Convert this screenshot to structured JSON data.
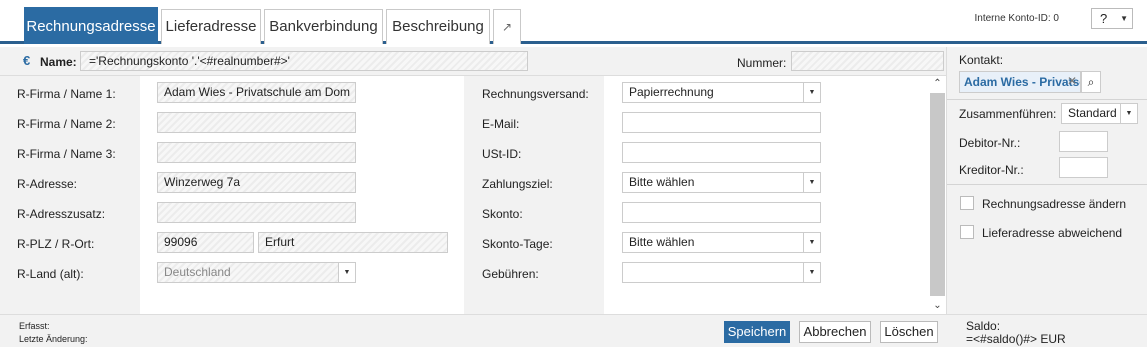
{
  "tabs": [
    {
      "label": "Rechnungsadresse",
      "active": true
    },
    {
      "label": "Lieferadresse"
    },
    {
      "label": "Bankverbindung"
    },
    {
      "label": "Beschreibung"
    }
  ],
  "expand_icon": "↗",
  "header": {
    "konto_id_label": "Interne Konto-ID: 0",
    "help_value": "?"
  },
  "name_row": {
    "currency_icon": "€",
    "name_label": "Name:",
    "name_value": "='Rechnungskonto '.'<#realnumber#>'",
    "nummer_label": "Nummer:"
  },
  "left_fields": [
    {
      "label": "R-Firma / Name 1:",
      "value": "Adam Wies - Privatschule am Dom"
    },
    {
      "label": "R-Firma / Name 2:",
      "value": ""
    },
    {
      "label": "R-Firma / Name 3:",
      "value": ""
    },
    {
      "label": "R-Adresse:",
      "value": "Winzerweg 7a"
    },
    {
      "label": "R-Adresszusatz:",
      "value": ""
    },
    {
      "label": "R-PLZ / R-Ort:",
      "plz": "99096",
      "ort": "Erfurt"
    },
    {
      "label": "R-Land (alt):",
      "value": "Deutschland"
    }
  ],
  "mid_fields": [
    {
      "label": "Rechnungsversand:",
      "value": "Papierrechnung"
    },
    {
      "label": "E-Mail:",
      "value": ""
    },
    {
      "label": "USt-ID:",
      "value": ""
    },
    {
      "label": "Zahlungsziel:",
      "value": "Bitte wählen"
    },
    {
      "label": "Skonto:",
      "value": ""
    },
    {
      "label": "Skonto-Tage:",
      "value": "Bitte wählen"
    },
    {
      "label": "Gebühren:",
      "value": ""
    }
  ],
  "right_panel": {
    "kontakt_label": "Kontakt:",
    "kontakt_value": "Adam Wies - Privatschule am Dom",
    "zusammenfuehren_label": "Zusammenführen:",
    "zusammenfuehren_value": "Standard",
    "debitor_label": "Debitor-Nr.:",
    "kreditor_label": "Kreditor-Nr.:",
    "checkbox_1": "Rechnungsadresse ändern",
    "checkbox_2": "Lieferadresse abweichend"
  },
  "footer": {
    "erfasst_label": "Erfasst:",
    "letzte_aenderung_label": "Letzte Änderung:",
    "save_label": "Speichern",
    "cancel_label": "Abbrechen",
    "delete_label": "Löschen",
    "saldo_label": "Saldo:",
    "saldo_value": "=<#saldo()#> EUR"
  },
  "colors": {
    "accent": "#2b6ba3",
    "panel": "#f2f2f2"
  }
}
